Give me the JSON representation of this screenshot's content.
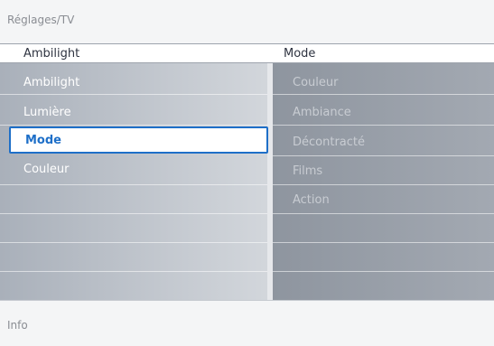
{
  "breadcrumb": "Réglages/TV",
  "header": {
    "left": "Ambilight",
    "right": "Mode"
  },
  "left_menu": [
    {
      "label": "Ambilight",
      "selected": false
    },
    {
      "label": "Lumière",
      "selected": false
    },
    {
      "label": "Mode",
      "selected": true
    },
    {
      "label": "Couleur",
      "selected": false
    }
  ],
  "right_menu": [
    "Couleur",
    "Ambiance",
    "Décontracté",
    "Films",
    "Action"
  ],
  "info": "Info",
  "colors": {
    "accent": "#1e6fc8",
    "panel": "#a9b0ba",
    "panel_dark": "#8e959f"
  }
}
